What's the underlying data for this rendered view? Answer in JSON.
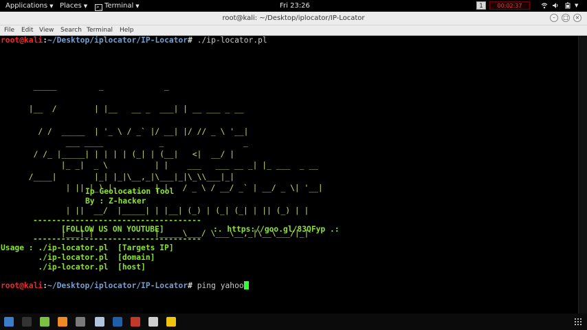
{
  "topbar": {
    "applications": "Applications",
    "places": "Places",
    "terminal": "Terminal",
    "clock": "Fri 23:26",
    "workspace": "1",
    "recorder": "00:02:37"
  },
  "window": {
    "title": "root@kali: ~/Desktop/iplocator/IP-Locator"
  },
  "menu": [
    "File",
    "Edit",
    "View",
    "Search",
    "Terminal",
    "Help"
  ],
  "terminal": {
    "prompt_user": "root@kali",
    "prompt_sep": ":",
    "prompt_path": "~/Desktop/iplocator/IP-Locator",
    "prompt_symbol": "#",
    "command1": " ./ip-locator.pl",
    "banner_zhacker": [
      "  _____         _             _",
      " |__  /        | |__   __ _  ___| | __ ___ _ __",
      "   / /  _____  | '_ \\ / _` |/ __| |/ // _ \\ '__|",
      "  / /_ |_____| | | | | (_| | (__|   <|  __/ |",
      " /____|        |_| |_|\\__,_|\\___|_|\\_\\\\___|_|"
    ],
    "banner_iplocator": [
      "  ___ ____            _                 _",
      " |_ _|  _ \\          | |    ___   ___ __ _| |_ ___  _ __",
      "  | || |_) |  _____  | |   / _ \\ / __/ _` | __/ _ \\| '__|",
      "  | ||  __/  |_____| | |__| (_) | (_| (_| | || (_) | |",
      " |___|_|             |_____\\___/ \\___\\__,_|\\__\\___/|_|"
    ],
    "tool_name": "Ip Geolocation Tool",
    "author": "By : Z-hacker",
    "dashes": "------------------------------------",
    "follow": "[FOLLOW US ON YOUTUBE]",
    "link": ":. https://goo.gl/83QFyp .:",
    "usage": [
      "Usage : ./ip-locator.pl  [Targets IP]",
      "        ./ip-locator.pl  [domain]",
      "        ./ip-locator.pl  [host]"
    ],
    "command2": " ping yahoo"
  },
  "dock": {
    "icons": [
      "files-icon",
      "terminal-icon",
      "notes-icon",
      "burpsuite-icon",
      "metasploit-icon",
      "eye-icon",
      "maltego-icon",
      "armitage-icon",
      "wifi-tool-icon",
      "cherrytree-icon"
    ],
    "colors": [
      "#3d7cc9",
      "#333333",
      "#7bc043",
      "#f08a24",
      "#7a7a7a",
      "#b0c4de",
      "#1e5fa8",
      "#c0392b",
      "#cfcfcf",
      "#f1c40f"
    ]
  }
}
